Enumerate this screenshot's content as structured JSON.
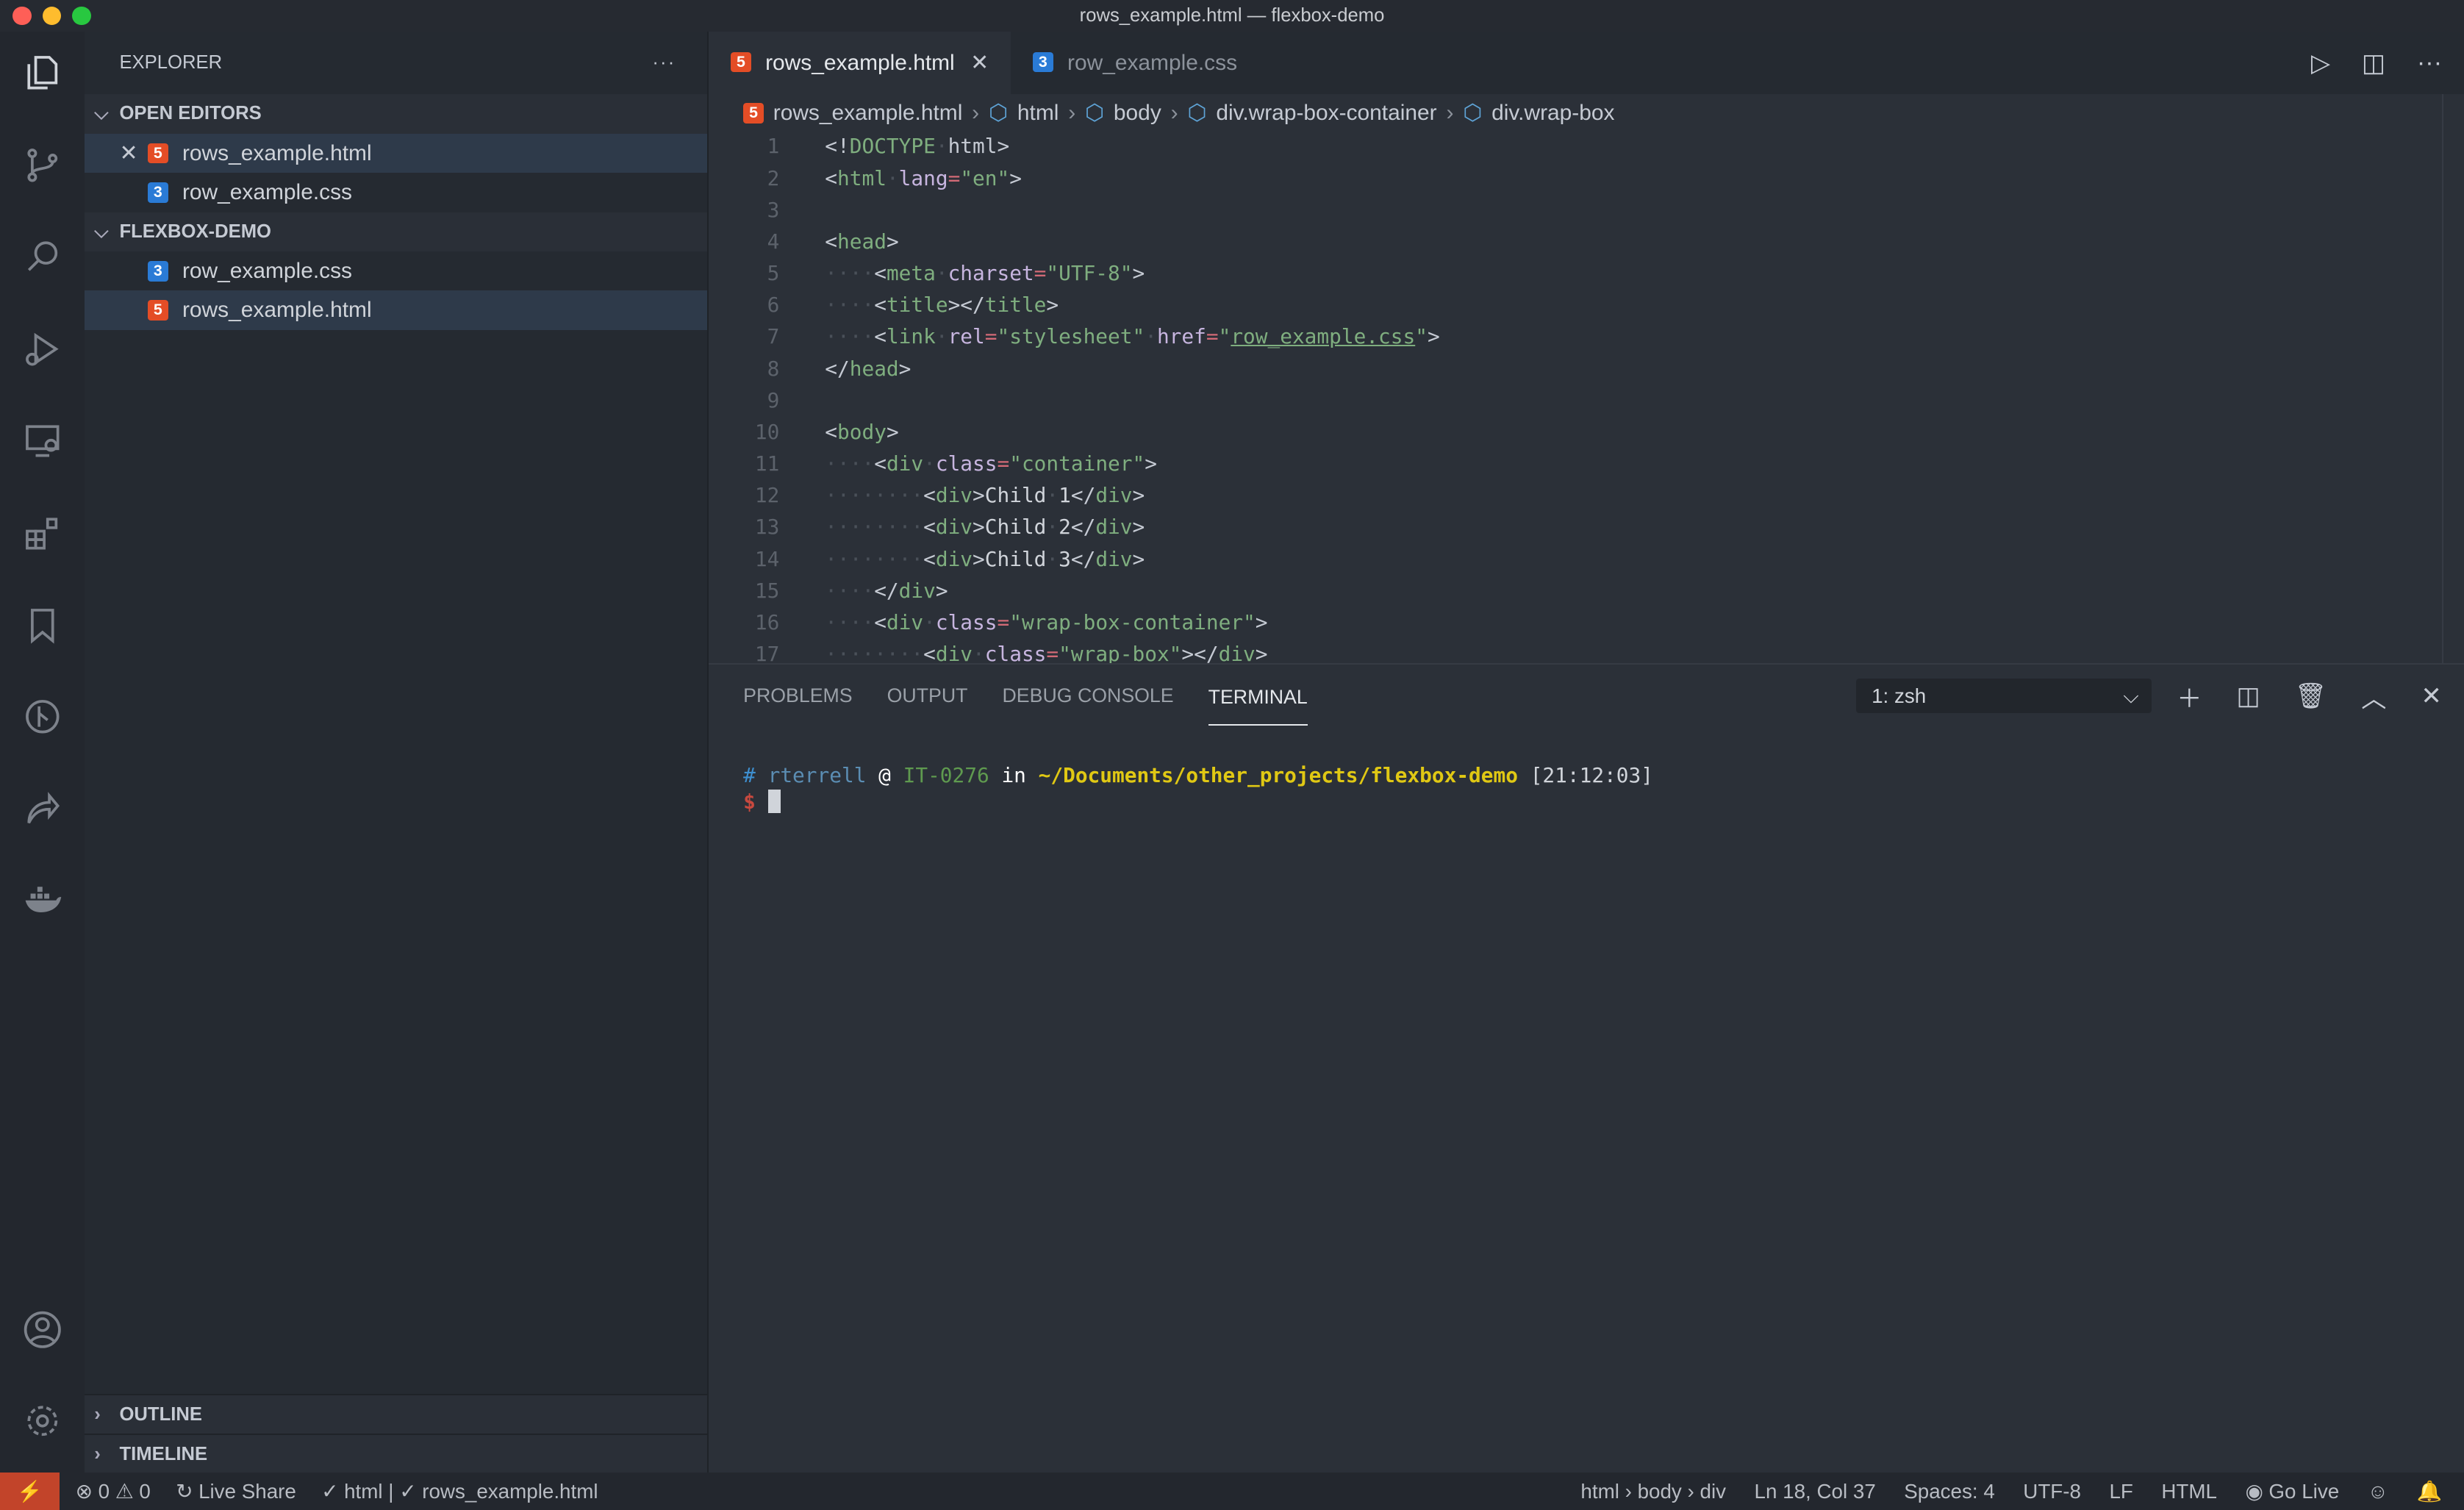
{
  "window_title": "rows_example.html — flexbox-demo",
  "sidebar": {
    "title": "EXPLORER",
    "more": "···",
    "open_editors": {
      "label": "OPEN EDITORS",
      "items": [
        {
          "name": "rows_example.html",
          "type": "html"
        },
        {
          "name": "row_example.css",
          "type": "css"
        }
      ]
    },
    "folder": {
      "label": "FLEXBOX-DEMO",
      "items": [
        {
          "name": "row_example.css",
          "type": "css"
        },
        {
          "name": "rows_example.html",
          "type": "html"
        }
      ]
    },
    "outline": "OUTLINE",
    "timeline": "TIMELINE"
  },
  "tabs": [
    {
      "label": "rows_example.html",
      "active": true
    },
    {
      "label": "row_example.css",
      "active": false
    }
  ],
  "breadcrumb": [
    "rows_example.html",
    "html",
    "body",
    "div.wrap-box-container",
    "div.wrap-box"
  ],
  "code": [
    [
      [
        "p",
        "<!"
      ],
      [
        "doc",
        "DOCTYPE"
      ],
      [
        "ws",
        "·"
      ],
      [
        "p",
        "html>"
      ]
    ],
    [
      [
        "p",
        "<"
      ],
      [
        "tag",
        "html"
      ],
      [
        "ws",
        "·"
      ],
      [
        "attr",
        "lang"
      ],
      [
        "eq",
        "="
      ],
      [
        "str",
        "\"en\""
      ],
      [
        "p",
        ">"
      ]
    ],
    [],
    [
      [
        "p",
        "<"
      ],
      [
        "tag",
        "head"
      ],
      [
        "p",
        ">"
      ]
    ],
    [
      [
        "ws",
        "····"
      ],
      [
        "p",
        "<"
      ],
      [
        "tag",
        "meta"
      ],
      [
        "ws",
        "·"
      ],
      [
        "attr",
        "charset"
      ],
      [
        "eq",
        "="
      ],
      [
        "str",
        "\"UTF-8\""
      ],
      [
        "p",
        ">"
      ]
    ],
    [
      [
        "ws",
        "····"
      ],
      [
        "p",
        "<"
      ],
      [
        "tag",
        "title"
      ],
      [
        "p",
        "></"
      ],
      [
        "tag",
        "title"
      ],
      [
        "p",
        ">"
      ]
    ],
    [
      [
        "ws",
        "····"
      ],
      [
        "p",
        "<"
      ],
      [
        "tag",
        "link"
      ],
      [
        "ws",
        "·"
      ],
      [
        "attr",
        "rel"
      ],
      [
        "eq",
        "="
      ],
      [
        "str",
        "\"stylesheet\""
      ],
      [
        "ws",
        "·"
      ],
      [
        "attr",
        "href"
      ],
      [
        "eq",
        "="
      ],
      [
        "str",
        "\""
      ],
      [
        "link",
        "row_example.css"
      ],
      [
        "str",
        "\""
      ],
      [
        "p",
        ">"
      ]
    ],
    [
      [
        "p",
        "</"
      ],
      [
        "tag",
        "head"
      ],
      [
        "p",
        ">"
      ]
    ],
    [],
    [
      [
        "p",
        "<"
      ],
      [
        "tag",
        "body"
      ],
      [
        "p",
        ">"
      ]
    ],
    [
      [
        "ws",
        "····"
      ],
      [
        "p",
        "<"
      ],
      [
        "tag",
        "div"
      ],
      [
        "ws",
        "·"
      ],
      [
        "attr",
        "class"
      ],
      [
        "eq",
        "="
      ],
      [
        "str",
        "\"container\""
      ],
      [
        "p",
        ">"
      ]
    ],
    [
      [
        "ws",
        "········"
      ],
      [
        "p",
        "<"
      ],
      [
        "tag",
        "div"
      ],
      [
        "p",
        ">"
      ],
      [
        "txt",
        "Child"
      ],
      [
        "ws",
        "·"
      ],
      [
        "txt",
        "1"
      ],
      [
        "p",
        "</"
      ],
      [
        "tag",
        "div"
      ],
      [
        "p",
        ">"
      ]
    ],
    [
      [
        "ws",
        "········"
      ],
      [
        "p",
        "<"
      ],
      [
        "tag",
        "div"
      ],
      [
        "p",
        ">"
      ],
      [
        "txt",
        "Child"
      ],
      [
        "ws",
        "·"
      ],
      [
        "txt",
        "2"
      ],
      [
        "p",
        "</"
      ],
      [
        "tag",
        "div"
      ],
      [
        "p",
        ">"
      ]
    ],
    [
      [
        "ws",
        "········"
      ],
      [
        "p",
        "<"
      ],
      [
        "tag",
        "div"
      ],
      [
        "p",
        ">"
      ],
      [
        "txt",
        "Child"
      ],
      [
        "ws",
        "·"
      ],
      [
        "txt",
        "3"
      ],
      [
        "p",
        "</"
      ],
      [
        "tag",
        "div"
      ],
      [
        "p",
        ">"
      ]
    ],
    [
      [
        "ws",
        "····"
      ],
      [
        "p",
        "</"
      ],
      [
        "tag",
        "div"
      ],
      [
        "p",
        ">"
      ]
    ],
    [
      [
        "ws",
        "····"
      ],
      [
        "p",
        "<"
      ],
      [
        "tag",
        "div"
      ],
      [
        "ws",
        "·"
      ],
      [
        "attr",
        "class"
      ],
      [
        "eq",
        "="
      ],
      [
        "str",
        "\"wrap-box-container\""
      ],
      [
        "p",
        ">"
      ]
    ],
    [
      [
        "ws",
        "········"
      ],
      [
        "p",
        "<"
      ],
      [
        "tag",
        "div"
      ],
      [
        "ws",
        "·"
      ],
      [
        "attr",
        "class"
      ],
      [
        "eq",
        "="
      ],
      [
        "str",
        "\"wrap-box\""
      ],
      [
        "p",
        "></"
      ],
      [
        "tag",
        "div"
      ],
      [
        "p",
        ">"
      ]
    ]
  ],
  "panel": {
    "tabs": [
      {
        "label": "PROBLEMS"
      },
      {
        "label": "OUTPUT"
      },
      {
        "label": "DEBUG CONSOLE"
      },
      {
        "label": "TERMINAL",
        "active": true
      }
    ],
    "terminal_select": "1: zsh",
    "terminal": {
      "hash": "#",
      "user": "rterrell",
      "at": "@",
      "host": "IT-0276",
      "in": "in",
      "path": "~/Documents/other_projects/flexbox-demo",
      "time": "[21:12:03]",
      "prompt": "$"
    }
  },
  "status": {
    "errors": "0",
    "warnings": "0",
    "live_share": "Live Share",
    "check": "✓ html | ✓ rows_example.html",
    "breadcrumb": "html › body › div",
    "position": "Ln 18, Col 37",
    "spaces": "Spaces: 4",
    "encoding": "UTF-8",
    "eol": "LF",
    "language": "HTML",
    "go_live": "Go Live"
  },
  "colors": {
    "remote": "#c2442a",
    "html_icon": "#e44d26",
    "css_icon": "#2a7bd6",
    "term_user": "#5b8db3",
    "term_host": "#5f9a4f",
    "term_path": "#e0c814",
    "term_prompt": "#c8493f"
  }
}
